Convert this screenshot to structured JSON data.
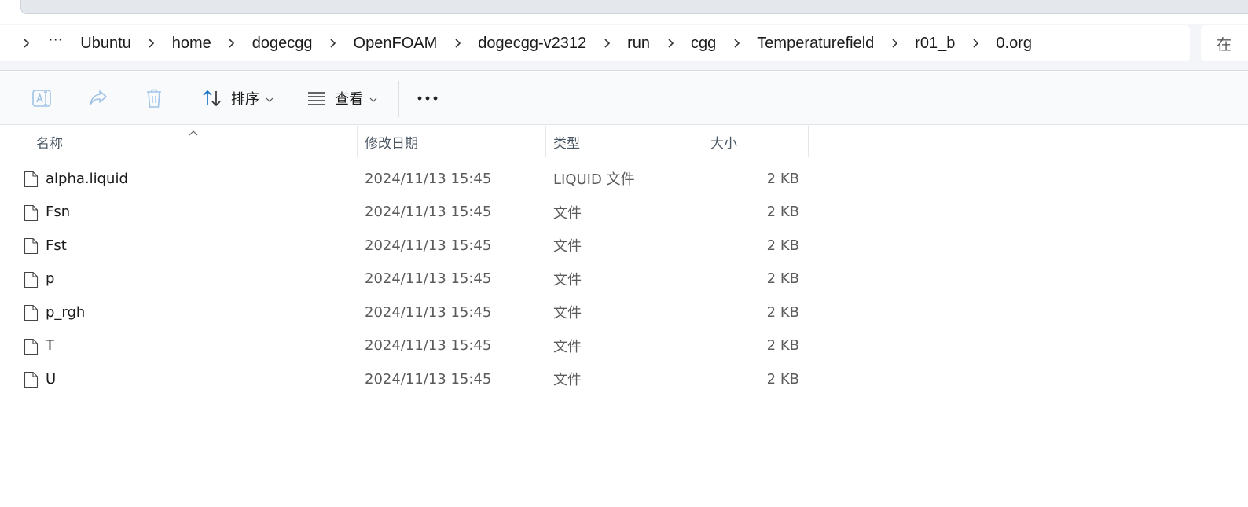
{
  "window": {
    "search_placeholder": "在"
  },
  "breadcrumb": {
    "items": [
      "Ubuntu",
      "home",
      "dogecgg",
      "OpenFOAM",
      "dogecgg-v2312",
      "run",
      "cgg",
      "Temperaturefield",
      "r01_b",
      "0.org"
    ]
  },
  "toolbar": {
    "sort_label": "排序",
    "view_label": "查看"
  },
  "columns": {
    "name": "名称",
    "date": "修改日期",
    "type": "类型",
    "size": "大小"
  },
  "files": [
    {
      "name": "alpha.liquid",
      "date": "2024/11/13 15:45",
      "type": "LIQUID 文件",
      "size": "2 KB"
    },
    {
      "name": "Fsn",
      "date": "2024/11/13 15:45",
      "type": "文件",
      "size": "2 KB"
    },
    {
      "name": "Fst",
      "date": "2024/11/13 15:45",
      "type": "文件",
      "size": "2 KB"
    },
    {
      "name": "p",
      "date": "2024/11/13 15:45",
      "type": "文件",
      "size": "2 KB"
    },
    {
      "name": "p_rgh",
      "date": "2024/11/13 15:45",
      "type": "文件",
      "size": "2 KB"
    },
    {
      "name": "T",
      "date": "2024/11/13 15:45",
      "type": "文件",
      "size": "2 KB"
    },
    {
      "name": "U",
      "date": "2024/11/13 15:45",
      "type": "文件",
      "size": "2 KB"
    }
  ],
  "icons": {
    "rename": "rename-icon",
    "share": "share-icon",
    "delete": "trash-icon",
    "sort": "sort-arrows-icon",
    "view": "view-lines-icon",
    "more": "more-horizontal-icon",
    "file": "file-icon"
  },
  "colors": {
    "accent": "#1a73c8",
    "disabled_icon": "#9fc3e6"
  }
}
